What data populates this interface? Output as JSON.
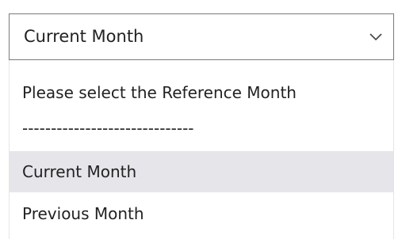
{
  "select": {
    "selected_value": "Current Month",
    "chevron_icon": "chevron-down-icon"
  },
  "dropdown": {
    "options": [
      {
        "label": "Please select the Reference Month"
      },
      {
        "label": "------------------------------"
      },
      {
        "label": "Current Month",
        "highlighted": true
      },
      {
        "label": "Previous Month"
      }
    ],
    "highlight_color": "#e5e5ea"
  }
}
